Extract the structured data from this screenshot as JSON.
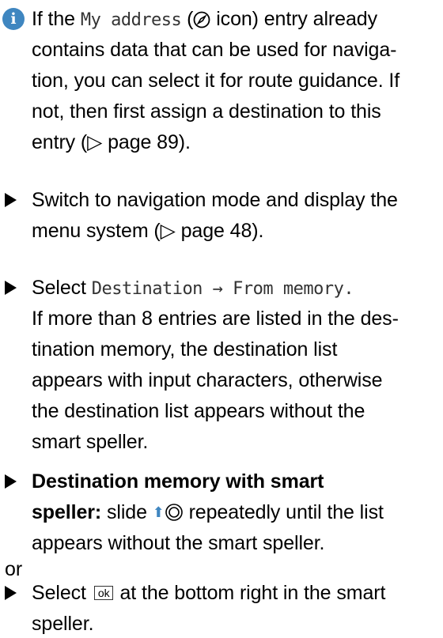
{
  "info_note": {
    "prefix": "If the ",
    "my_address": "My address",
    "paren_open": " (",
    "icon_name": "compass-icon",
    "after_icon": " icon) entry already",
    "line2": "contains data that can be used for naviga-",
    "line3": "tion, you can select it for route guidance. If",
    "line4": "not, then first assign a destination to this",
    "line5": "entry (▷ page 89)."
  },
  "step1": {
    "line1": "Switch to navigation mode and display the",
    "line2": "menu system (▷ page 48)."
  },
  "step2": {
    "select_word": "Select ",
    "menu_path": "Destination → From memory.",
    "line2": "If more than 8 entries are listed in the des-",
    "line3": "tination memory, the destination list",
    "line4": "appears with input characters, otherwise",
    "line5": "the destination list appears without the",
    "line6": "smart speller."
  },
  "step3": {
    "bold1": "Destination memory with smart",
    "bold2": "speller:",
    "after_bold": " slide ",
    "control_icon": "slide-up-controller-icon",
    "rest": " repeatedly until the list",
    "line3": "appears without the smart speller."
  },
  "or_text": "or",
  "step4": {
    "select_word": "Select",
    "ok_label": "ok",
    "rest": "at the bottom right in the smart",
    "line2": "speller."
  },
  "colors": {
    "info_icon": "#3f86c0",
    "text": "#000000"
  }
}
